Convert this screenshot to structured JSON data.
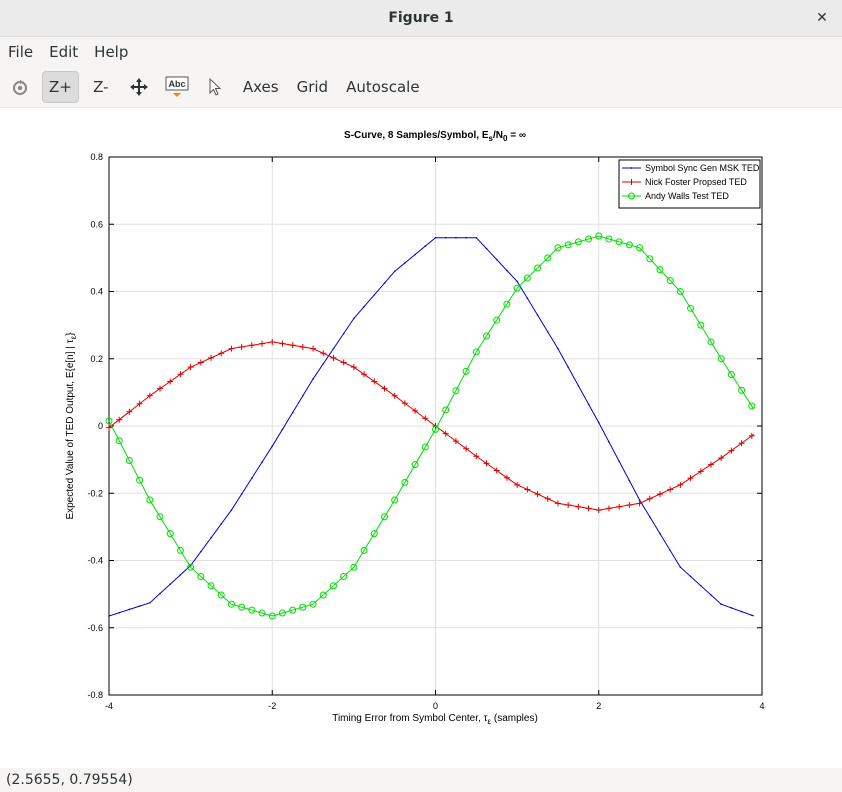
{
  "window": {
    "title": "Figure 1"
  },
  "menu": {
    "file": "File",
    "edit": "Edit",
    "help": "Help"
  },
  "toolbar": {
    "zoom_in": "Z+",
    "zoom_out": "Z-",
    "text_tool": "Abc",
    "axes": "Axes",
    "grid": "Grid",
    "autoscale": "Autoscale"
  },
  "status": {
    "coords": "(2.5655, 0.79554)"
  },
  "chart_data": {
    "type": "line",
    "title_prefix": "S-Curve, 8 Samples/Symbol, E",
    "title_sub1": "s",
    "title_mid": "/N",
    "title_sub2": "0",
    "title_suffix": " = ∞",
    "xlabel_prefix": "Timing Error from Symbol Center, τ",
    "xlabel_sub": "ε",
    "xlabel_suffix": " (samples)",
    "ylabel_prefix": "Expected Value of TED Output, E{e[n] | τ",
    "ylabel_sub": "ε",
    "ylabel_suffix": "}",
    "xlim": [
      -4,
      4
    ],
    "ylim": [
      -0.8,
      0.8
    ],
    "xticks": [
      -4,
      -2,
      0,
      2,
      4
    ],
    "yticks": [
      -0.8,
      -0.6,
      -0.4,
      -0.2,
      0,
      0.2,
      0.4,
      0.6,
      0.8
    ],
    "xtick_labels": [
      "-4",
      "-2",
      "0",
      "2",
      "4"
    ],
    "ytick_labels": [
      "-0.8",
      "-0.6",
      "-0.4",
      "-0.2",
      "0",
      "0.2",
      "0.4",
      "0.6",
      "0.8"
    ],
    "grid": true,
    "legend_position": "top-right",
    "series": [
      {
        "name": "Symbol Sync Gen MSK TED",
        "color": "#0000cc",
        "marker": "dot",
        "x": [
          -4,
          -3.5,
          -3,
          -2.5,
          -2,
          -1.5,
          -1,
          -0.5,
          0,
          0.5,
          1,
          1.5,
          2,
          2.5,
          3,
          3.5,
          3.9
        ],
        "y": [
          -0.565,
          -0.526,
          -0.415,
          -0.25,
          -0.06,
          0.14,
          0.32,
          0.46,
          0.56,
          0.56,
          0.43,
          0.23,
          0.01,
          -0.22,
          -0.42,
          -0.53,
          -0.565
        ]
      },
      {
        "name": "Nick Foster Propsed TED",
        "color": "#e00000",
        "marker": "plus",
        "x": [
          -4,
          -3.5,
          -3,
          -2.5,
          -2,
          -1.5,
          -1,
          -0.5,
          0,
          0.5,
          1,
          1.5,
          2,
          2.5,
          3,
          3.5,
          3.9
        ],
        "y": [
          -0.005,
          0.09,
          0.175,
          0.23,
          0.25,
          0.23,
          0.175,
          0.09,
          0.0,
          -0.09,
          -0.175,
          -0.23,
          -0.25,
          -0.23,
          -0.175,
          -0.095,
          -0.025
        ]
      },
      {
        "name": "Andy Walls Test TED",
        "color": "#00dd00",
        "marker": "circle",
        "x": [
          -4,
          -3.5,
          -3,
          -2.5,
          -2,
          -1.5,
          -1,
          -0.5,
          0,
          0.5,
          1,
          1.5,
          2,
          2.5,
          3,
          3.5,
          3.9
        ],
        "y": [
          0.015,
          -0.22,
          -0.42,
          -0.53,
          -0.565,
          -0.53,
          -0.42,
          -0.22,
          -0.01,
          0.22,
          0.41,
          0.53,
          0.565,
          0.53,
          0.4,
          0.2,
          0.05
        ]
      }
    ]
  }
}
